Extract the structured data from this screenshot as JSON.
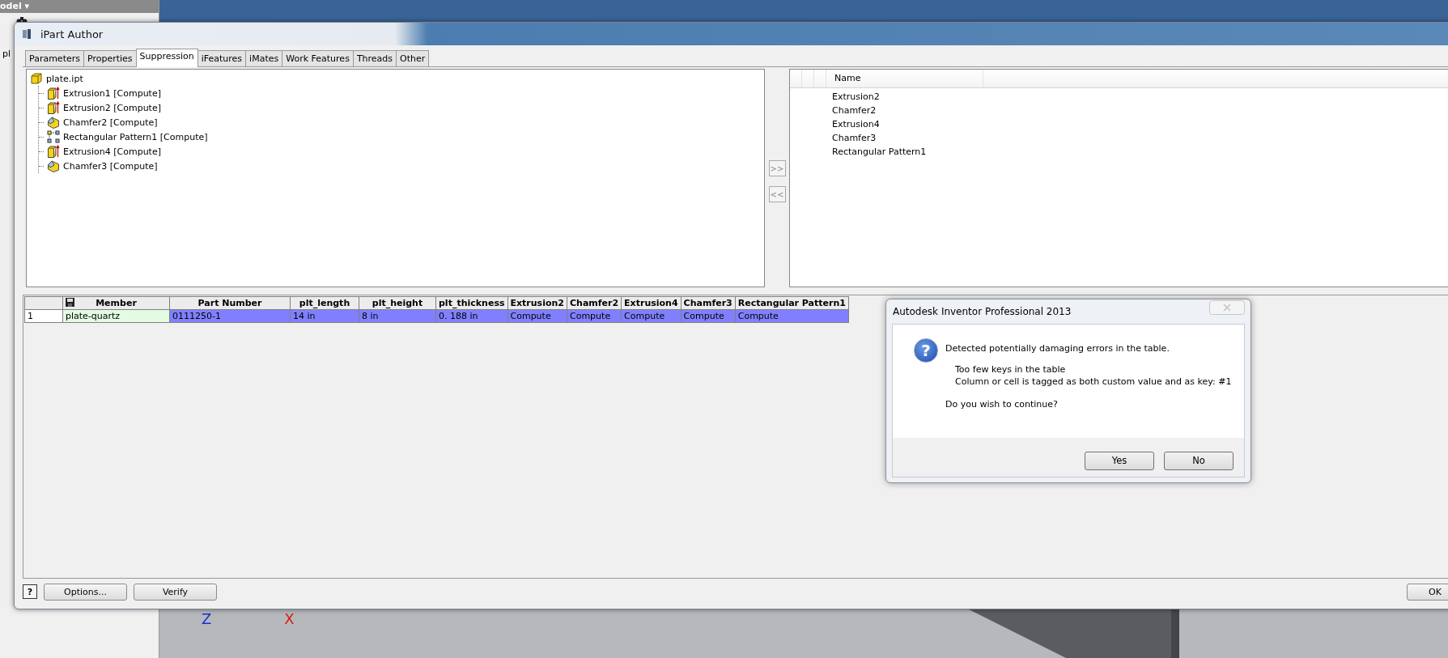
{
  "backdrop": {
    "browser_title": "odel ▾",
    "browser_item": "pl",
    "axis_labels": [
      {
        "text": "Z",
        "color": "#1a2fd0"
      },
      {
        "text": "X",
        "color": "#d81c1c"
      }
    ]
  },
  "window": {
    "title": "iPart Author"
  },
  "tabs": [
    {
      "label": "Parameters",
      "selected": false
    },
    {
      "label": "Properties",
      "selected": false
    },
    {
      "label": "Suppression",
      "selected": true
    },
    {
      "label": "iFeatures",
      "selected": false
    },
    {
      "label": "iMates",
      "selected": false
    },
    {
      "label": "Work Features",
      "selected": false
    },
    {
      "label": "Threads",
      "selected": false
    },
    {
      "label": "Other",
      "selected": false
    }
  ],
  "feature_tree": {
    "root": "plate.ipt",
    "children": [
      {
        "label": "Extrusion1 [Compute]",
        "kind": "extrusion"
      },
      {
        "label": "Extrusion2 [Compute]",
        "kind": "extrusion"
      },
      {
        "label": "Chamfer2 [Compute]",
        "kind": "chamfer"
      },
      {
        "label": "Rectangular Pattern1 [Compute]",
        "kind": "pattern"
      },
      {
        "label": "Extrusion4 [Compute]",
        "kind": "extrusion"
      },
      {
        "label": "Chamfer3 [Compute]",
        "kind": "chamfer"
      }
    ]
  },
  "move_buttons": [
    ">>",
    "<<"
  ],
  "suppressed_list": {
    "column": "Name",
    "rows": [
      "Extrusion2",
      "Chamfer2",
      "Extrusion4",
      "Chamfer3",
      "Rectangular Pattern1"
    ]
  },
  "table": {
    "columns": [
      "Member",
      "Part Number",
      "plt_length",
      "plt_height",
      "plt_thickness",
      "Extrusion2",
      "Chamfer2",
      "Extrusion4",
      "Chamfer3",
      "Rectangular Pattern1"
    ],
    "rows": [
      {
        "number": "1",
        "selected": true,
        "cells": [
          "plate-quartz",
          "0111250-1",
          "14 in",
          "8 in",
          "0. 188 in",
          "Compute",
          "Compute",
          "Compute",
          "Compute",
          "Compute"
        ]
      }
    ]
  },
  "buttons": {
    "help": "?",
    "options": "Options...",
    "verify": "Verify",
    "ok": "OK"
  },
  "message": {
    "title": "Autodesk Inventor Professional 2013",
    "icon": "?",
    "headline": "Detected potentially damaging errors in the table.",
    "details": [
      "Too few keys in the table",
      "Column or cell is tagged as both custom value and as key: #1"
    ],
    "question": "Do you wish to continue?",
    "buttons": [
      "Yes",
      "No"
    ]
  }
}
